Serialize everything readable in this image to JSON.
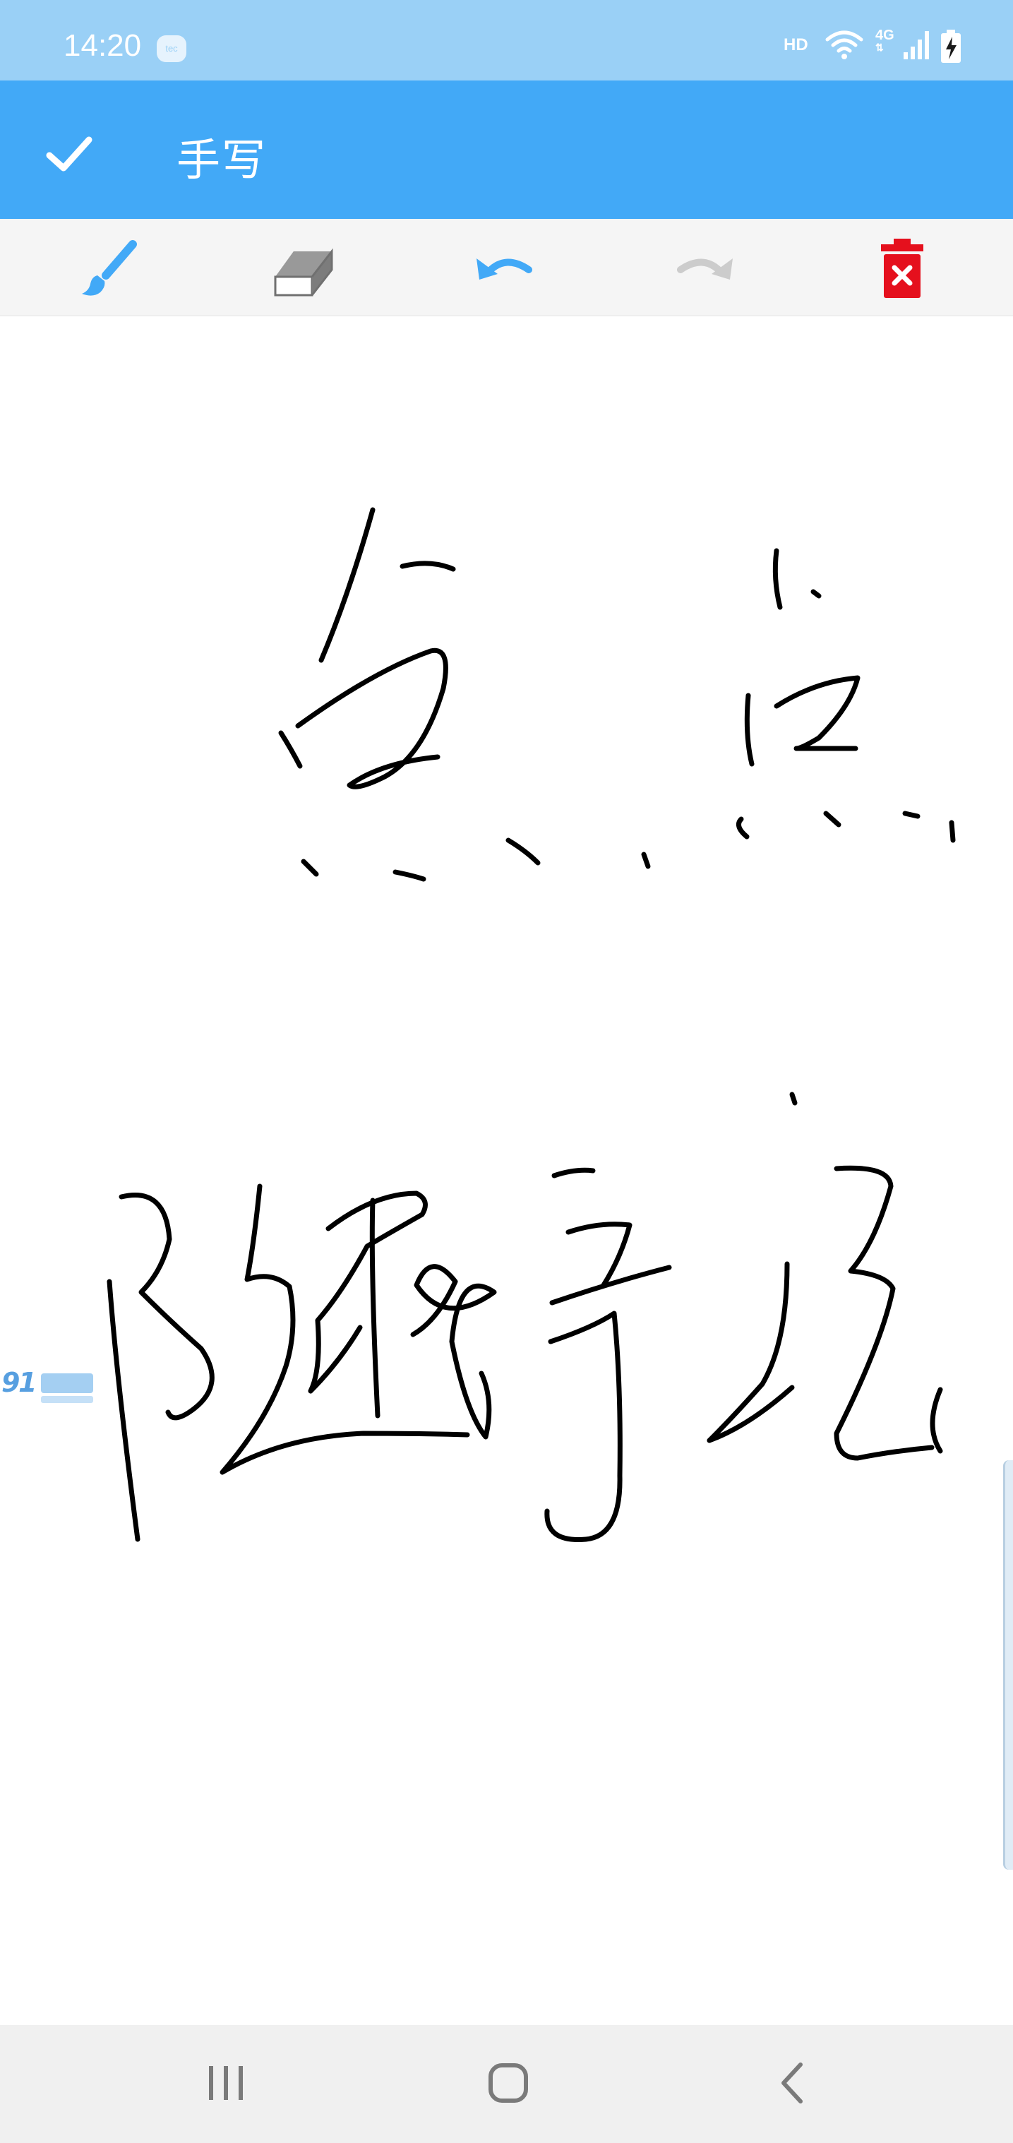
{
  "status_bar": {
    "time": "14:20",
    "badge": "tec",
    "network_type": "HD",
    "mobile_data": "4G",
    "icons": [
      "wifi-icon",
      "4g-signal-icon",
      "cellular-signal-icon",
      "battery-charging-icon"
    ]
  },
  "app_bar": {
    "title": "手写",
    "confirm_icon": "check-icon"
  },
  "toolbar": {
    "tools": [
      {
        "name": "brush-icon",
        "color": "#42a9f7",
        "enabled": true
      },
      {
        "name": "eraser-icon",
        "color": "#808080",
        "enabled": true
      },
      {
        "name": "undo-icon",
        "color": "#42a9f7",
        "enabled": true
      },
      {
        "name": "redo-icon",
        "color": "#cccccc",
        "enabled": false
      },
      {
        "name": "clear-all-icon",
        "color": "#e5101d",
        "enabled": true
      }
    ]
  },
  "canvas": {
    "watermark_icon": "91-game-logo",
    "ink_color": "#000000"
  },
  "nav_bar": {
    "icons": [
      "recent-apps-icon",
      "home-icon",
      "back-icon"
    ]
  },
  "colors": {
    "status_bar": "#9ad0f6",
    "app_bar": "#42a9f7",
    "toolbar": "#f5f5f5",
    "nav_bar": "#f0f0f0"
  }
}
